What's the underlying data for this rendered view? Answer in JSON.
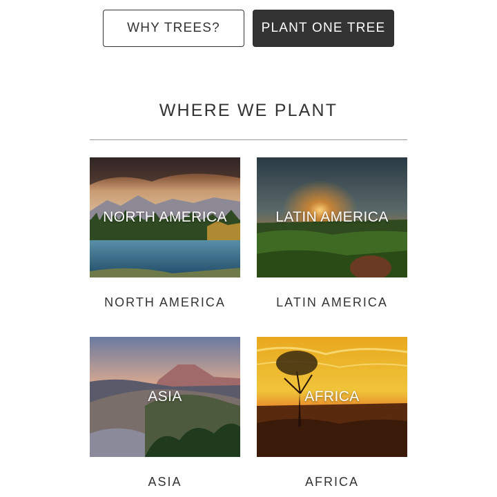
{
  "buttons": {
    "why_trees": "WHY TREES?",
    "plant_one_tree": "PLANT ONE TREE"
  },
  "section": {
    "title": "WHERE WE PLANT"
  },
  "regions": [
    {
      "overlay": "NORTH AMERICA",
      "caption": "NORTH AMERICA"
    },
    {
      "overlay": "LATIN AMERICA",
      "caption": "LATIN AMERICA"
    },
    {
      "overlay": "ASIA",
      "caption": "ASIA"
    },
    {
      "overlay": "AFRICA",
      "caption": "AFRICA"
    }
  ],
  "colors": {
    "dark_button": "#333333",
    "text": "#333333"
  }
}
